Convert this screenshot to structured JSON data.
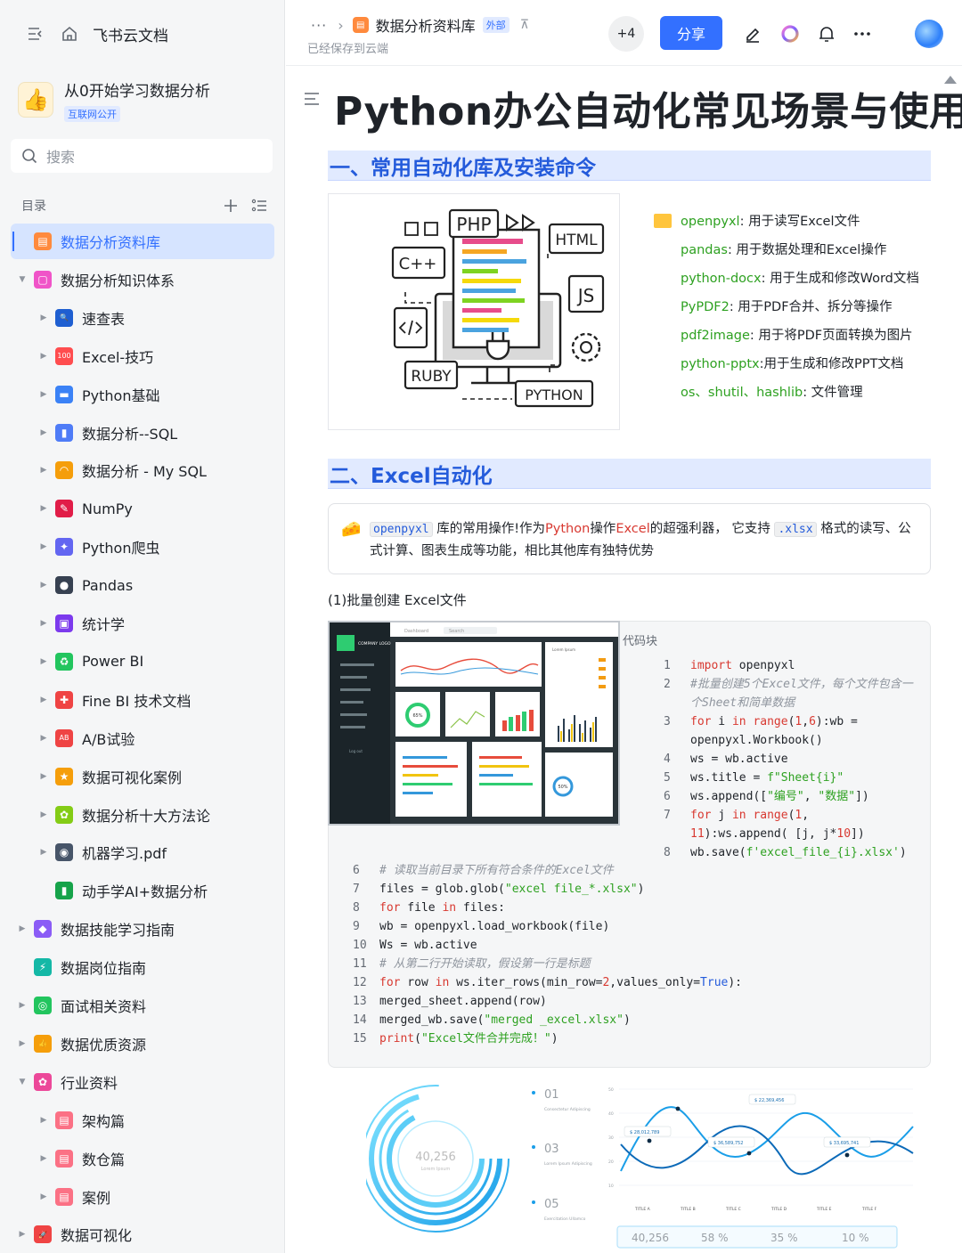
{
  "sidebar": {
    "brand": "飞书云文档",
    "space": {
      "name": "从0开始学习数据分析",
      "tag": "互联网公开"
    },
    "search_placeholder": "搜索",
    "toc_label": "目录",
    "items": [
      {
        "label": "数据分析资料库",
        "active": true,
        "level": 0,
        "arrow": "",
        "icon": "#ff8a3d",
        "glyph": "▤"
      },
      {
        "label": "数据分析知识体系",
        "level": 0,
        "arrow": "▼",
        "icon": "#f054c8",
        "glyph": "▢"
      },
      {
        "label": "速查表",
        "level": 1,
        "arrow": "▶",
        "icon": "#1f5fd1",
        "glyph": "🔍"
      },
      {
        "label": "Excel-技巧",
        "level": 1,
        "arrow": "▶",
        "icon": "#ff4d4f",
        "glyph": "100"
      },
      {
        "label": "Python基础",
        "level": 1,
        "arrow": "▶",
        "icon": "#3b82f6",
        "glyph": "▬"
      },
      {
        "label": "数据分析--SQL",
        "level": 1,
        "arrow": "▶",
        "icon": "#4f7cf7",
        "glyph": "▮"
      },
      {
        "label": "数据分析 - My SQL",
        "level": 1,
        "arrow": "▶",
        "icon": "#f59e0b",
        "glyph": "◠"
      },
      {
        "label": "NumPy",
        "level": 1,
        "arrow": "▶",
        "icon": "#e11d48",
        "glyph": "✎"
      },
      {
        "label": "Python爬虫",
        "level": 1,
        "arrow": "▶",
        "icon": "#6366f1",
        "glyph": "✦"
      },
      {
        "label": "Pandas",
        "level": 1,
        "arrow": "▶",
        "icon": "#374151",
        "glyph": "●"
      },
      {
        "label": "统计学",
        "level": 1,
        "arrow": "▶",
        "icon": "#7c3aed",
        "glyph": "▣"
      },
      {
        "label": "Power BI",
        "level": 1,
        "arrow": "▶",
        "icon": "#22c55e",
        "glyph": "♻"
      },
      {
        "label": "Fine BI 技术文档",
        "level": 1,
        "arrow": "▶",
        "icon": "#ef4444",
        "glyph": "✚"
      },
      {
        "label": "A/B试验",
        "level": 1,
        "arrow": "▶",
        "icon": "#ef4444",
        "glyph": "AB"
      },
      {
        "label": "数据可视化案例",
        "level": 1,
        "arrow": "▶",
        "icon": "#f59e0b",
        "glyph": "★"
      },
      {
        "label": "数据分析十大方法论",
        "level": 1,
        "arrow": "▶",
        "icon": "#84cc16",
        "glyph": "✿"
      },
      {
        "label": "机器学习.pdf",
        "level": 1,
        "arrow": "▶",
        "icon": "#475569",
        "glyph": "◉"
      },
      {
        "label": "动手学AI+数据分析",
        "level": 1,
        "arrow": "",
        "icon": "#16a34a",
        "glyph": "▮"
      },
      {
        "label": "数据技能学习指南",
        "level": 0,
        "arrow": "▶",
        "icon": "#8b5cf6",
        "glyph": "◆"
      },
      {
        "label": "数据岗位指南",
        "level": 0,
        "arrow": "",
        "icon": "#14b8a6",
        "glyph": "⚡"
      },
      {
        "label": "面试相关资料",
        "level": 0,
        "arrow": "▶",
        "icon": "#22c55e",
        "glyph": "◎"
      },
      {
        "label": "数据优质资源",
        "level": 0,
        "arrow": "▶",
        "icon": "#f59e0b",
        "glyph": "👍"
      },
      {
        "label": "行业资料",
        "level": 0,
        "arrow": "▼",
        "icon": "#ec4899",
        "glyph": "✿"
      },
      {
        "label": "架构篇",
        "level": 1,
        "arrow": "▶",
        "icon": "#fb7185",
        "glyph": "▤"
      },
      {
        "label": "数仓篇",
        "level": 1,
        "arrow": "▶",
        "icon": "#fb7185",
        "glyph": "▤"
      },
      {
        "label": "案例",
        "level": 1,
        "arrow": "▶",
        "icon": "#fb7185",
        "glyph": "▤"
      },
      {
        "label": "数据可视化",
        "level": 0,
        "arrow": "▶",
        "icon": "#ef4444",
        "glyph": "🚀"
      }
    ]
  },
  "header": {
    "breadcrumb_more": "···",
    "doc_name": "数据分析资料库",
    "ext_tag": "外部",
    "saved": "已经保存到云端",
    "collaborators": "+4",
    "share": "分享"
  },
  "doc": {
    "title": "Python办公自动化常见场景与使用",
    "section1": "一、常用自动化库及安装命令",
    "illus_labels": {
      "php": "PHP",
      "html": "HTML",
      "cpp": "C++",
      "js": "JS",
      "ruby": "RUBY",
      "python": "PYTHON"
    },
    "libs": [
      {
        "key": "openpyxl",
        "desc": ": 用于读写Excel文件"
      },
      {
        "key": "pandas",
        "desc": ": 用于数据处理和Excel操作"
      },
      {
        "key": "python-docx",
        "desc": ": 用于生成和修改Word文档"
      },
      {
        "key": "PyPDF2",
        "desc": ": 用于PDF合并、拆分等操作"
      },
      {
        "key": "pdf2image",
        "desc": ": 用于将PDF页面转换为图片"
      },
      {
        "key": "python-pptx",
        "desc": ":用于生成和修改PPT文档"
      },
      {
        "key": "os、shutil、hashlib",
        "desc": ": 文件管理"
      }
    ],
    "section2": "二、Excel自动化",
    "callout": {
      "code1": "openpyxl",
      "t1": "库的常用操作!作为",
      "py": "Python",
      "t2": "操作",
      "excel": "Excel",
      "t3": "的超强利器，  它支持",
      "code2": ".xlsx",
      "t4": "格式的读写、公式计算、图表生成等功能，相比其他库有独特优势"
    },
    "subheading": "(1)批量创建 Excel文件",
    "code_label": "代码块",
    "dash_labels": {
      "logo": "COMPANY LOGO",
      "dashboard": "Dashboard",
      "search": "Search",
      "logout": "Log out",
      "lorem": "Lorem Ipsum",
      "pct65": "65%",
      "pct50": "50%"
    },
    "viz": {
      "ring_value": "40,256",
      "ring_sub": "Lorem Ipsum",
      "steps": [
        {
          "n": "01",
          "t": "Consectetur Adipiscing"
        },
        {
          "n": "03",
          "t": "Lorem Ipsum Adipiscing"
        },
        {
          "n": "05",
          "t": "Exercitation Ullamco"
        }
      ],
      "callouts": [
        "$ 22,369,456",
        "$ 28,012,789",
        "$ 36,589,752",
        "$ 33,695,741"
      ],
      "yticks": [
        "50",
        "40",
        "30",
        "20",
        "10"
      ],
      "xticks": [
        "TITLE A",
        "TITLE B",
        "TITLE C",
        "TITLE D",
        "TITLE E",
        "TITLE F"
      ],
      "stats": [
        "40,256",
        "58 %",
        "35 %",
        "10 %"
      ]
    }
  }
}
